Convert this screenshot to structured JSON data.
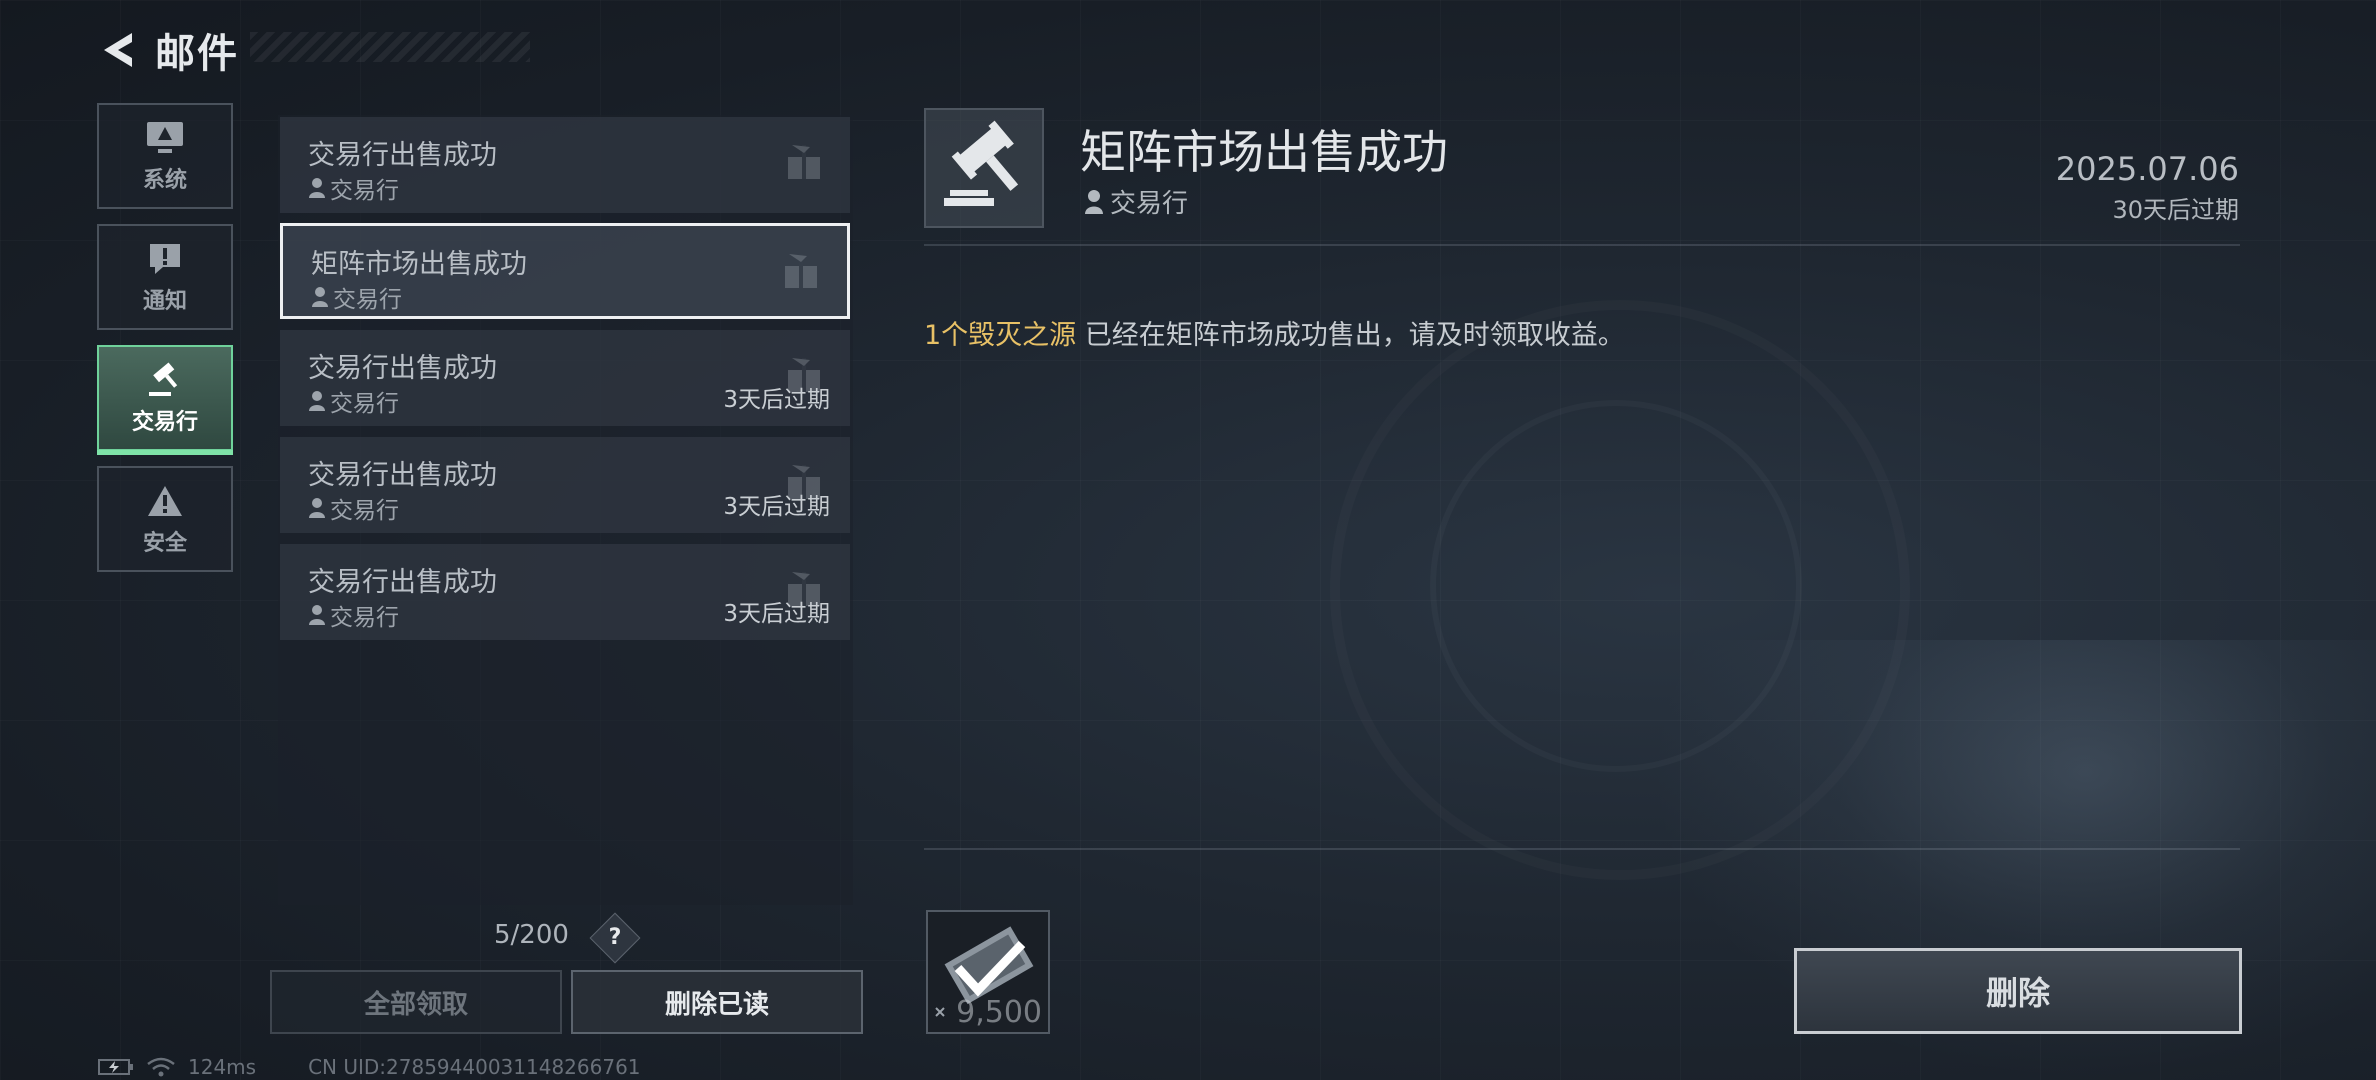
{
  "header": {
    "title": "邮件"
  },
  "tabs": [
    {
      "label": "系统",
      "icon": "monitor-icon"
    },
    {
      "label": "通知",
      "icon": "alert-bubble-icon"
    },
    {
      "label": "交易行",
      "icon": "gavel-icon",
      "active": true
    },
    {
      "label": "安全",
      "icon": "warning-triangle-icon"
    }
  ],
  "mails": [
    {
      "title": "交易行出售成功",
      "sender": "交易行",
      "expire": ""
    },
    {
      "title": "矩阵市场出售成功",
      "sender": "交易行",
      "expire": "",
      "selected": true
    },
    {
      "title": "交易行出售成功",
      "sender": "交易行",
      "expire": "3天后过期"
    },
    {
      "title": "交易行出售成功",
      "sender": "交易行",
      "expire": "3天后过期"
    },
    {
      "title": "交易行出售成功",
      "sender": "交易行",
      "expire": "3天后过期"
    }
  ],
  "list_footer": {
    "count": "5/200",
    "help": "?"
  },
  "buttons": {
    "claim_all": "全部领取",
    "delete_read": "删除已读",
    "delete": "删除"
  },
  "detail": {
    "title": "矩阵市场出售成功",
    "sender": "交易行",
    "date": "2025.07.06",
    "expire": "30天后过期",
    "body_highlight": "1个毁灭之源",
    "body_text": " 已经在矩阵市场成功售出，请及时领取收益。",
    "attachment_amount": "9,500"
  },
  "status_bar": {
    "ping": "124ms",
    "uid": "CN UID:278594400311482667​61"
  },
  "colors": {
    "accent_green": "#6fd29b",
    "highlight_gold": "#e8c166",
    "selected_border": "#eef0f2"
  }
}
